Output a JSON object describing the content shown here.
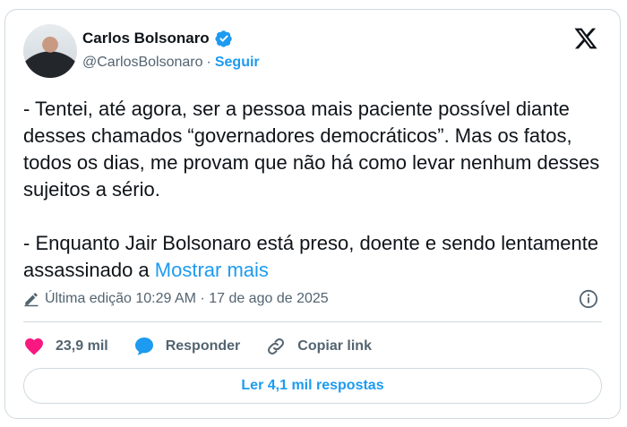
{
  "author": {
    "name": "Carlos Bolsonaro",
    "handle": "@CarlosBolsonaro",
    "separator": "·",
    "follow_label": "Seguir"
  },
  "tweet": {
    "text": "- Tentei, até agora, ser a pessoa mais paciente possível diante desses chamados “governadores democráticos”. Mas os fatos, todos os dias, me provam que não há como levar nenhum desses sujeitos a sério.\n\n- Enquanto Jair Bolsonaro está preso, doente e sendo lentamente assassinado a ",
    "show_more": "Mostrar mais"
  },
  "meta": {
    "edited_label": "Última edição 10:29 AM · 17 de ago de 2025"
  },
  "actions": {
    "likes": "23,9 mil",
    "reply_label": "Responder",
    "copy_link_label": "Copiar link"
  },
  "replies_button": "Ler 4,1 mil respostas",
  "colors": {
    "accent": "#1d9bf0",
    "like": "#f91880",
    "text": "#0f1419",
    "secondary": "#536471",
    "border": "#cfd9de"
  },
  "icons": [
    "verified-badge-icon",
    "x-logo-icon",
    "edit-pencil-icon",
    "info-icon",
    "heart-icon",
    "speech-bubble-icon",
    "link-icon"
  ]
}
